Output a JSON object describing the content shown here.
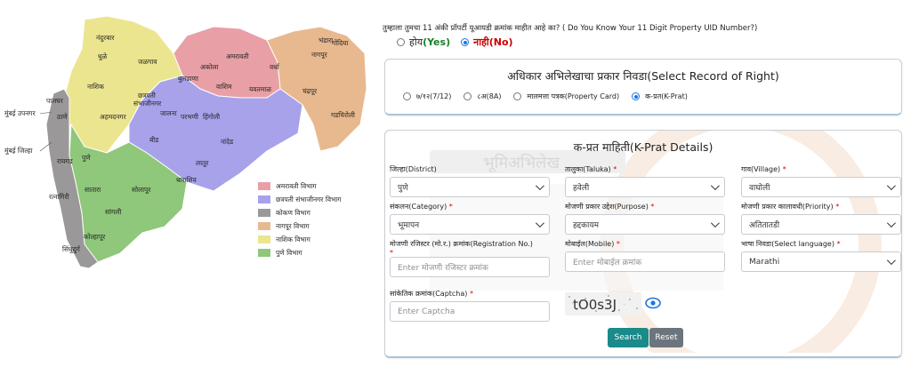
{
  "map": {
    "outside_labels": {
      "mumbai_suburban": "मुंबई उपनगर",
      "mumbai_city": "मुंबई जिल्हा"
    },
    "districts": [
      {
        "name": "नंदुरबार"
      },
      {
        "name": "धुळे"
      },
      {
        "name": "जळगाव"
      },
      {
        "name": "नाशिक"
      },
      {
        "name": "अहमदनगर"
      },
      {
        "name": "छत्रपती संभाजीनगर"
      },
      {
        "name": "बुलढाणा"
      },
      {
        "name": "अकोला"
      },
      {
        "name": "अमरावती"
      },
      {
        "name": "वाशिम"
      },
      {
        "name": "यवतमाळ"
      },
      {
        "name": "वर्धा"
      },
      {
        "name": "नागपूर"
      },
      {
        "name": "भंडारा"
      },
      {
        "name": "गोंदिया"
      },
      {
        "name": "चंद्रपूर"
      },
      {
        "name": "गडचिरोली"
      },
      {
        "name": "जालना"
      },
      {
        "name": "परभणी"
      },
      {
        "name": "हिंगोली"
      },
      {
        "name": "नांदेड"
      },
      {
        "name": "बीड"
      },
      {
        "name": "लातूर"
      },
      {
        "name": "धाराशिव"
      },
      {
        "name": "पालघर"
      },
      {
        "name": "ठाणे"
      },
      {
        "name": "रायगड"
      },
      {
        "name": "पुणे"
      },
      {
        "name": "सातारा"
      },
      {
        "name": "सोलापूर"
      },
      {
        "name": "रत्नागिरी"
      },
      {
        "name": "सांगली"
      },
      {
        "name": "कोल्हापूर"
      },
      {
        "name": "सिंधुदुर्ग"
      }
    ],
    "legend": [
      {
        "label": "अमरावती विभाग",
        "color": "#e8a0a6"
      },
      {
        "label": "छत्रपती संभाजीनगर विभाग",
        "color": "#a7a2ea"
      },
      {
        "label": "कोकण विभाग",
        "color": "#9a9898"
      },
      {
        "label": "नागपूर विभाग",
        "color": "#e8b98e"
      },
      {
        "label": "नाशिक विभाग",
        "color": "#ece58f"
      },
      {
        "label": "पुणे विभाग",
        "color": "#8fc77b"
      }
    ]
  },
  "question": {
    "text": "तुम्हाला तुमचा 11 अंकी प्रॉपर्टी यूआयडी क्रमांक माहीत आहे का? ( Do You Know Your 11 Digit Property UID Number?)",
    "yes_mr": "होय",
    "yes_en": "(Yes)",
    "no_label": "नाही(No)",
    "selected": "no"
  },
  "record": {
    "title": "अधिकार अभिलेखाचा प्रकार निवडा(Select Record of Right)",
    "options": [
      {
        "label": "७/१२(7/12)",
        "checked": false
      },
      {
        "label": "८अ(8A)",
        "checked": false
      },
      {
        "label": "मालमत्ता पत्रक(Property Card)",
        "checked": false
      },
      {
        "label": "क-प्रत(K-Prat)",
        "checked": true
      }
    ]
  },
  "form": {
    "title": "क-प्रत माहिती(K-Prat Details)",
    "watermark_text": "भूमिअभिलेख",
    "district": {
      "label": "जिल्हा(District)",
      "value": "पुणे"
    },
    "taluka": {
      "label": "तालुका(Taluka)",
      "req": "*",
      "value": "हवेली"
    },
    "village": {
      "label": "गाव(Village)",
      "req": "*",
      "value": "वाघोली"
    },
    "category": {
      "label": "संकलन(Category)",
      "req": "*",
      "value": "भूमापन"
    },
    "purpose": {
      "label": "मोजणी प्रकार उद्देश(Purpose)",
      "req": "*",
      "value": "हद्दकायम"
    },
    "priority": {
      "label": "मोजणी प्रकार कालावधी(Priority)",
      "req": "*",
      "value": "अतितातडी"
    },
    "registration": {
      "label": "मोजणी रजिस्टर (मो.र.) क्रमांक(Registration No.)",
      "req": "*",
      "placeholder": "Enter मोजणी रजिस्टर क्रमांक"
    },
    "mobile": {
      "label": "मोबाईल(Mobile)",
      "req": "*",
      "placeholder": "Enter मोबाईल क्रमांक"
    },
    "language": {
      "label": "भाषा निवडा(Select language)",
      "req": "*",
      "value": "Marathi"
    },
    "captcha": {
      "label": "सांकेतिक क्रमांक(Captcha)",
      "req": "*",
      "placeholder": "Enter Captcha",
      "code": "tO0s3J"
    },
    "search_label": "Search",
    "reset_label": "Reset",
    "colors": {
      "accent": "#1a8a8a",
      "reset": "#6c757d",
      "radio": "#1a73e8"
    }
  }
}
